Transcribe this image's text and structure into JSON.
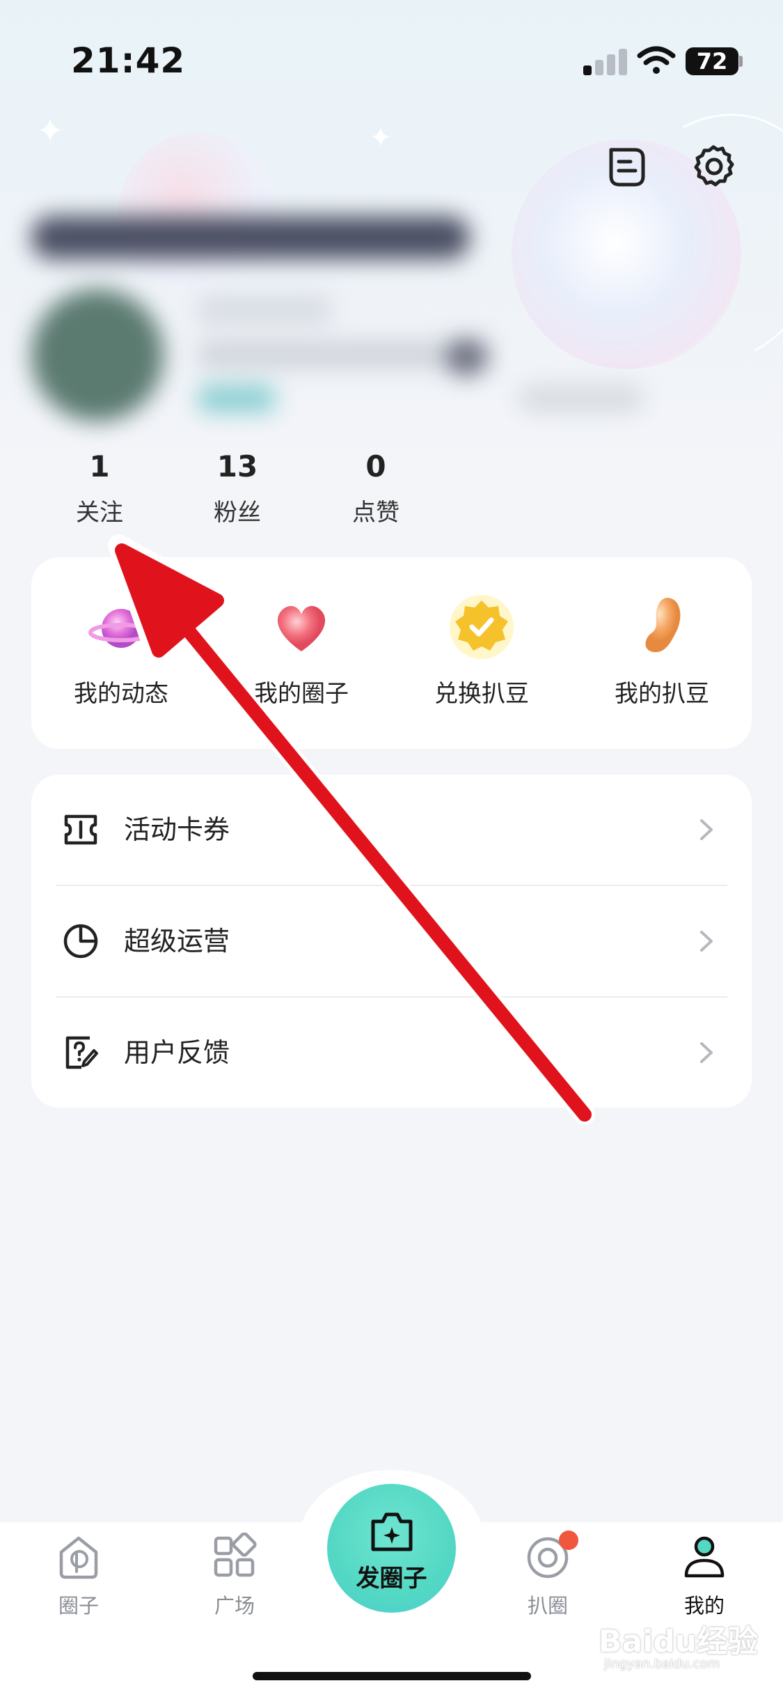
{
  "status_bar": {
    "time": "21:42",
    "battery": "72"
  },
  "stats": [
    {
      "value": "1",
      "label": "关注"
    },
    {
      "value": "13",
      "label": "粉丝"
    },
    {
      "value": "0",
      "label": "点赞"
    }
  ],
  "quick_actions": [
    {
      "label": "我的动态",
      "icon": "planet-icon"
    },
    {
      "label": "我的圈子",
      "icon": "heart-icon"
    },
    {
      "label": "兑换扒豆",
      "icon": "check-badge-icon"
    },
    {
      "label": "我的扒豆",
      "icon": "bean-icon"
    }
  ],
  "menu": [
    {
      "label": "活动卡券",
      "icon": "ticket-icon"
    },
    {
      "label": "超级运营",
      "icon": "pie-chart-icon"
    },
    {
      "label": "用户反馈",
      "icon": "feedback-icon"
    }
  ],
  "tabs": [
    {
      "label": "圈子",
      "icon": "circle-home-icon"
    },
    {
      "label": "广场",
      "icon": "grid-icon"
    },
    {
      "label": "发圈子",
      "icon": "camera-plus-icon"
    },
    {
      "label": "扒圈",
      "icon": "target-icon"
    },
    {
      "label": "我的",
      "icon": "user-icon"
    }
  ],
  "colors": {
    "accent": "#53d8c4",
    "badge": "#f0573f",
    "arrow": "#e0131c"
  },
  "watermark": {
    "brand": "Baidu经验",
    "url": "jingyan.baidu.com"
  }
}
